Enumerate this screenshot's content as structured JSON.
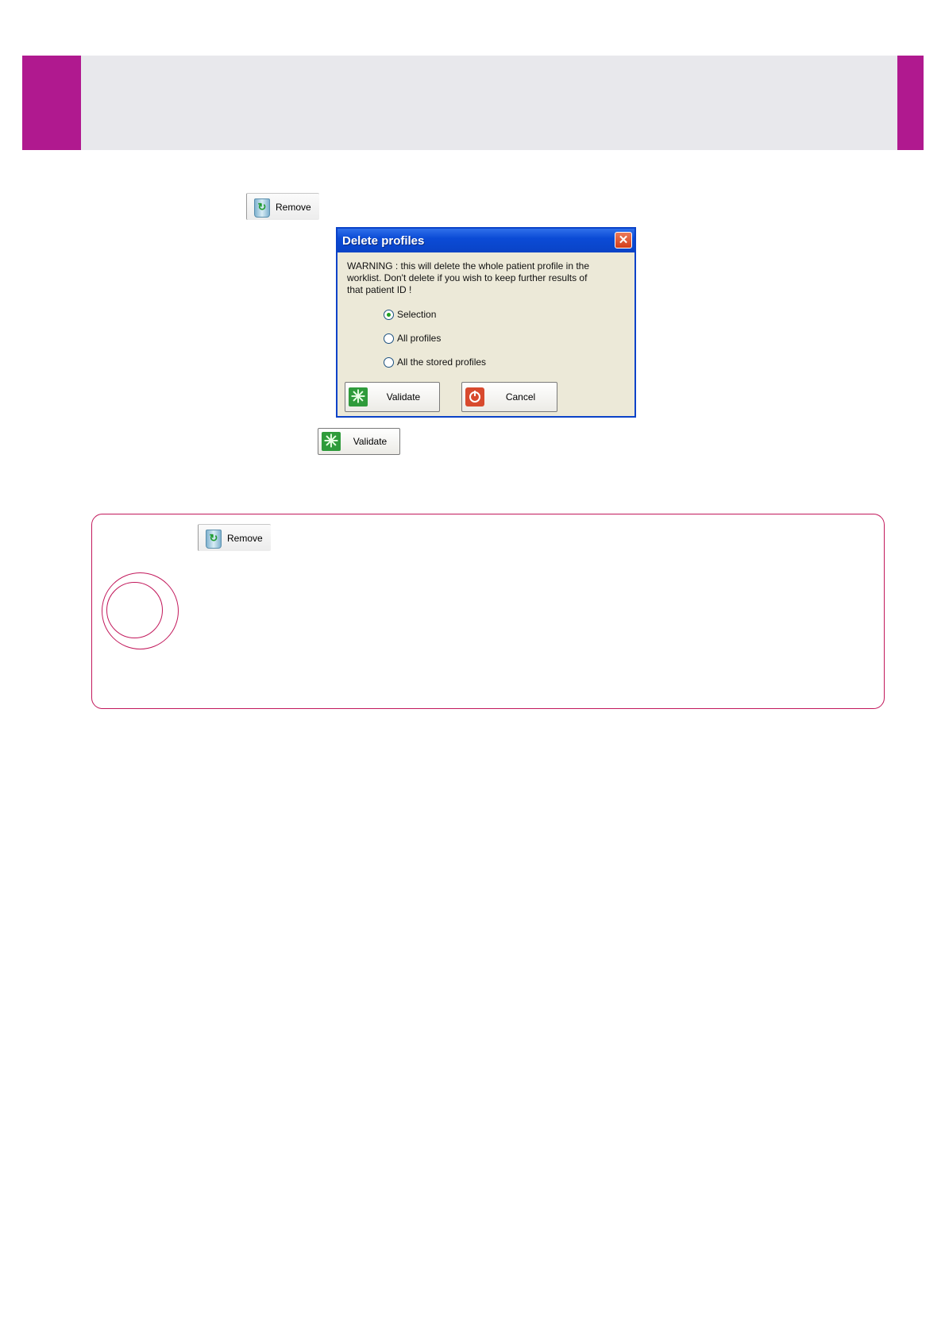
{
  "toolbar": {
    "remove_label": "Remove",
    "validate_label": "Validate"
  },
  "dialog": {
    "title": "Delete profiles",
    "close_glyph": "✕",
    "warning": "WARNING : this will delete the whole patient profile in the worklist. Don't delete if you wish to keep further results of that patient ID !",
    "options": [
      "Selection",
      "All profiles",
      "All the stored profiles"
    ],
    "selected_option": "Selection",
    "validate_label": "Validate",
    "cancel_label": "Cancel"
  },
  "note": {
    "remove_label": "Remove"
  },
  "icons": {
    "remove": "recycle-bin-icon",
    "validate": "validate-icon",
    "cancel": "power-icon",
    "close": "close-icon"
  },
  "colors": {
    "accent": "#b0198f",
    "note_border": "#c2185b",
    "titlebar": "#0a43c6"
  }
}
